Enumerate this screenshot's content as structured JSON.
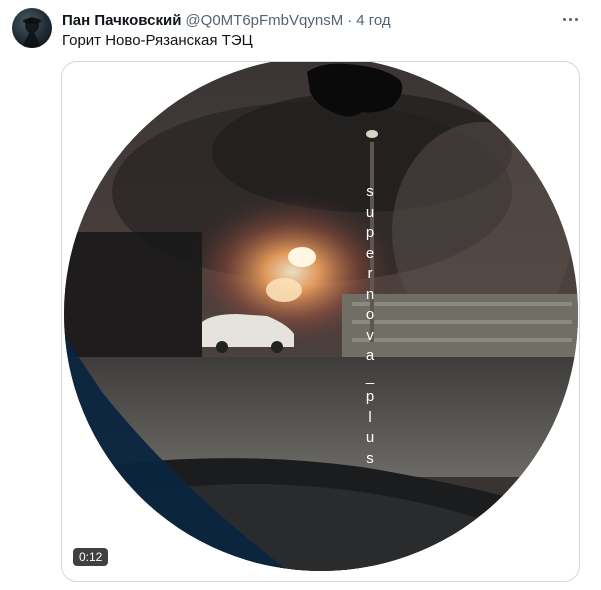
{
  "tweet": {
    "author_name": "Пан Пачковский",
    "author_handle": "@Q0MT6pFmbVqynsM",
    "separator": "·",
    "time": "4 год",
    "text": "Горит Ново-Рязанская ТЭЦ"
  },
  "media": {
    "duration": "0:12",
    "watermark_letters": [
      "s",
      "u",
      "p",
      "e",
      "r",
      "n",
      "o",
      "v",
      "a",
      "_",
      "p",
      "l",
      "u",
      "s"
    ]
  },
  "colors": {
    "name": "#0f1419",
    "secondary": "#536471",
    "border": "#cfd9de"
  },
  "icons": {
    "more": "ellipsis-icon",
    "avatar": "avatar-image"
  }
}
